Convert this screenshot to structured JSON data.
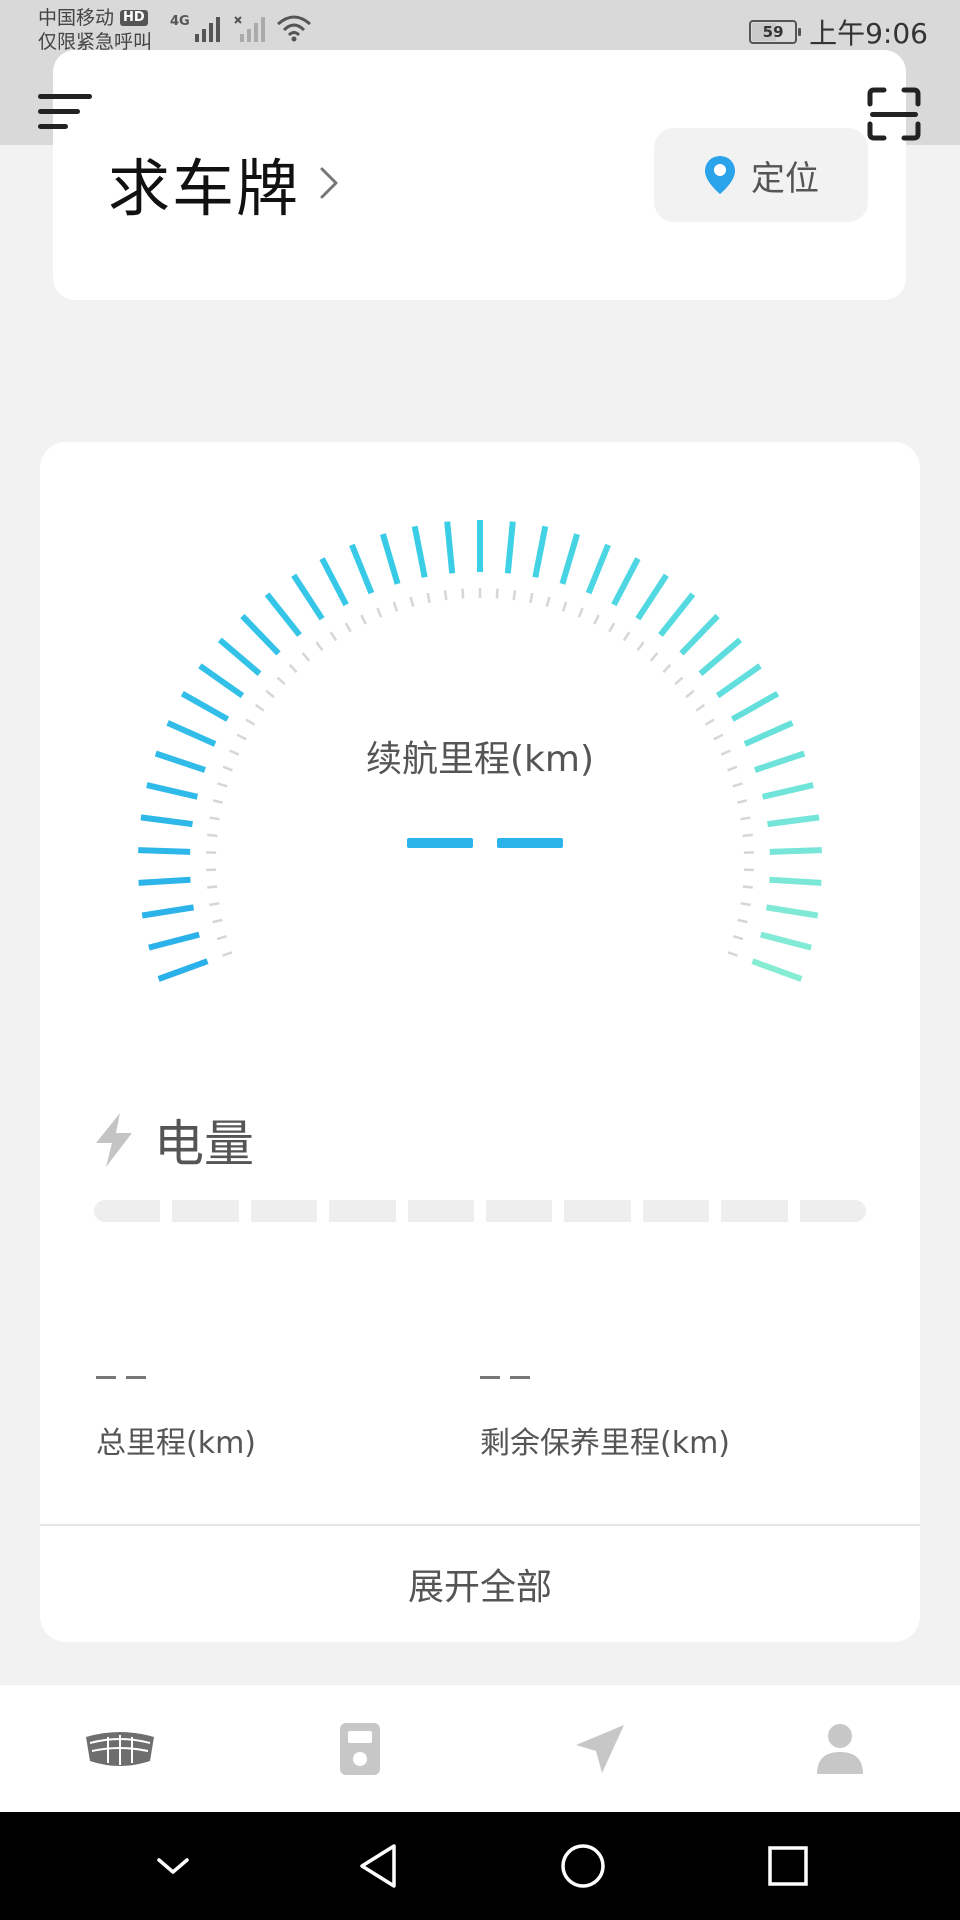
{
  "status_bar": {
    "carrier": "中国移动",
    "hd": "HD",
    "emergency": "仅限紧急呼叫",
    "network": "4G",
    "battery": "59",
    "time": "上午9:06"
  },
  "header": {
    "plate": "求车牌",
    "locate_label": "定位",
    "icons": [
      "menu-icon",
      "scan-icon",
      "chevron-right-icon",
      "location-pin-icon"
    ]
  },
  "gauge": {
    "label": "续航里程(km)",
    "value_placeholder": "— —",
    "colors": {
      "start": "#2ab0ea",
      "mid": "#3bd0e6",
      "end": "#86ecd4",
      "inner_dash": "#d6d6d6"
    }
  },
  "battery": {
    "label": "电量",
    "segments": 10,
    "level": 0,
    "icon": "lightning-icon"
  },
  "stats": {
    "total_mileage": {
      "value": "— —",
      "label": "总里程(km)"
    },
    "maintenance_remaining": {
      "value": "— —",
      "label": "剩余保养里程(km)"
    }
  },
  "expand_label": "展开全部",
  "tab_bar": {
    "tabs": [
      {
        "icon": "car-grille-icon",
        "active": true,
        "color": "#6e6e6e"
      },
      {
        "icon": "remote-key-icon",
        "active": false,
        "color": "#c7c7c7"
      },
      {
        "icon": "navigation-arrow-icon",
        "active": false,
        "color": "#c7c7c7"
      },
      {
        "icon": "user-icon",
        "active": false,
        "color": "#c7c7c7"
      }
    ]
  },
  "system_nav": {
    "buttons": [
      "collapse-chevron-icon",
      "back-icon",
      "home-icon",
      "recents-icon"
    ]
  }
}
